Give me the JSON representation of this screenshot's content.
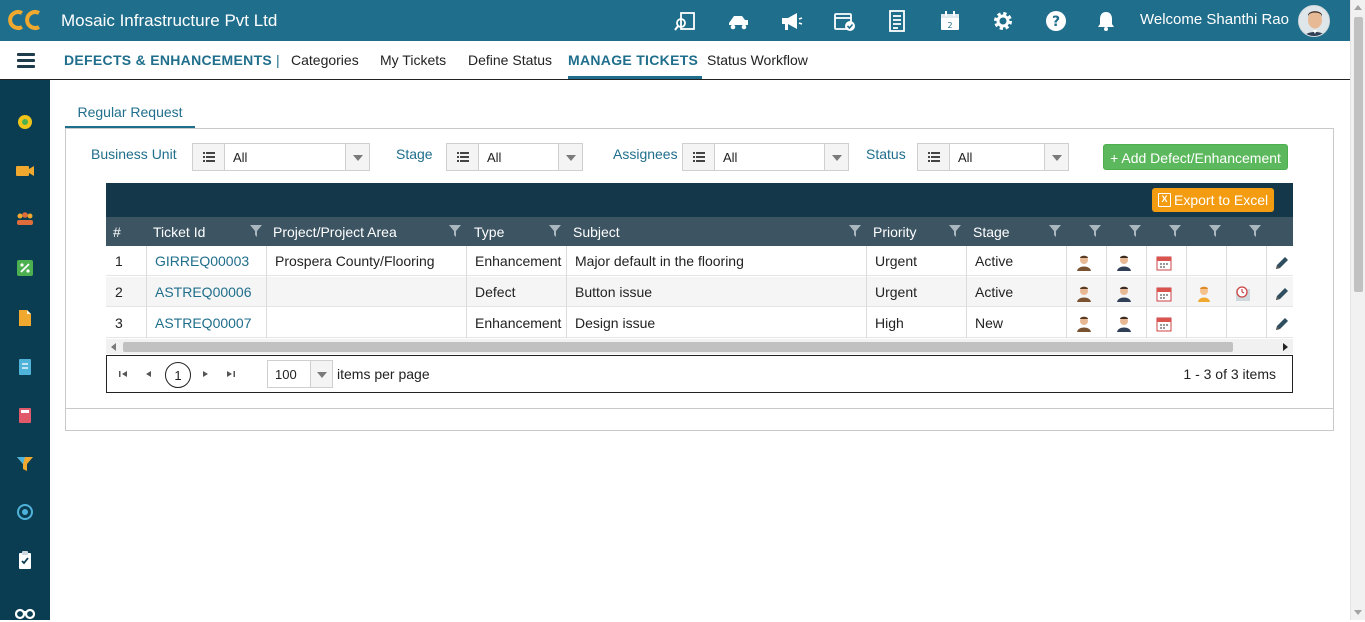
{
  "header": {
    "company": "Mosaic Infrastructure Pvt Ltd",
    "welcome": "Welcome Shanthi Rao",
    "icons": [
      "search-document-icon",
      "delivery-truck-icon",
      "megaphone-icon",
      "calendar-check-icon",
      "checklist-icon",
      "calendar-icon",
      "gear-icon",
      "help-icon"
    ],
    "brand_color": "#1f6e8c"
  },
  "nav": {
    "title": "DEFECTS & ENHANCEMENTS",
    "separator": "|",
    "links": [
      "Categories",
      "My Tickets",
      "Define Status",
      "MANAGE TICKETS",
      "Status Workflow"
    ],
    "active": "MANAGE TICKETS"
  },
  "tabs": {
    "regular": "Regular Request"
  },
  "filters": {
    "business_unit": {
      "label": "Business Unit",
      "value": "All"
    },
    "stage": {
      "label": "Stage",
      "value": "All"
    },
    "assignees": {
      "label": "Assignees",
      "value": "All"
    },
    "status": {
      "label": "Status",
      "value": "All"
    }
  },
  "actions": {
    "add": "+ Add Defect/Enhancement",
    "export": "Export to Excel",
    "add_color": "#5cb85c",
    "export_color": "#f39c12"
  },
  "grid": {
    "columns": [
      "#",
      "Ticket Id",
      "Project/Project Area",
      "Type",
      "Subject",
      "Priority",
      "Stage"
    ],
    "rows": [
      {
        "num": "1",
        "ticket": "GIRREQ00003",
        "project": "Prospera County/Flooring",
        "type": "Enhancement",
        "subject": "Major default in the flooring",
        "priority": "Urgent",
        "stage": "Active"
      },
      {
        "num": "2",
        "ticket": "ASTREQ00006",
        "project": "",
        "type": "Defect",
        "subject": "Button issue",
        "priority": "Urgent",
        "stage": "Active"
      },
      {
        "num": "3",
        "ticket": "ASTREQ00007",
        "project": "",
        "type": "Enhancement",
        "subject": "Design issue",
        "priority": "High",
        "stage": "New"
      }
    ]
  },
  "pager": {
    "page": "1",
    "page_size": "100",
    "items_per_page": "items per page",
    "info": "1 - 3 of 3 items"
  }
}
